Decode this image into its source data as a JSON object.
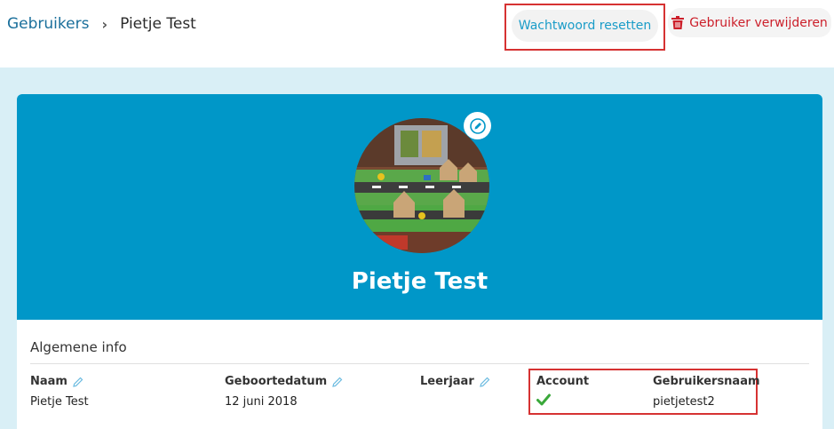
{
  "breadcrumb": {
    "parent": "Gebruikers",
    "separator": "›",
    "current": "Pietje Test"
  },
  "actions": {
    "reset_password": "Wachtwoord resetten",
    "delete_user": "Gebruiker verwijderen"
  },
  "profile": {
    "name": "Pietje Test"
  },
  "info": {
    "section_title": "Algemene info",
    "fields": [
      {
        "label": "Naam",
        "value": "Pietje Test"
      },
      {
        "label": "Geboortedatum",
        "value": "12 juni 2018"
      },
      {
        "label": "Leerjaar",
        "value": ""
      },
      {
        "label": "Account",
        "value": ""
      },
      {
        "label": "Gebruikersnaam",
        "value": "pietjetest2"
      }
    ]
  },
  "colors": {
    "header": "#0097c8",
    "page_background": "#d9eff6",
    "link": "#1a6f9b",
    "danger": "#cc1f2a",
    "success": "#3aa83a"
  }
}
